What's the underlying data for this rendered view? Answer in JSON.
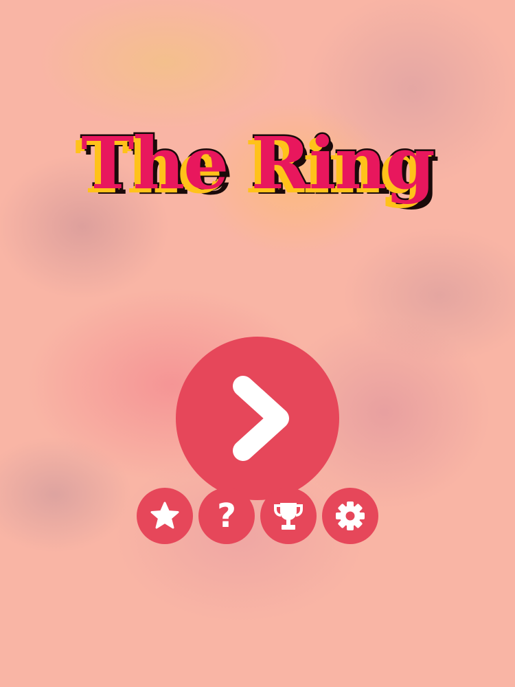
{
  "game": {
    "title": "The Ring"
  },
  "menu": {
    "play_icon": "chevron-right-icon",
    "buttons": [
      {
        "id": "rate",
        "icon": "star-icon"
      },
      {
        "id": "help",
        "icon": "question-icon",
        "glyph": "?"
      },
      {
        "id": "leaderboard",
        "icon": "trophy-icon"
      },
      {
        "id": "settings",
        "icon": "gear-icon"
      }
    ]
  },
  "colors": {
    "background": "#f9b5a5",
    "button": "#e6475a",
    "title_fill": "#e8175d",
    "title_shadow": "#ffc21a",
    "title_outline": "#1a0a0a",
    "icon": "#ffffff"
  }
}
